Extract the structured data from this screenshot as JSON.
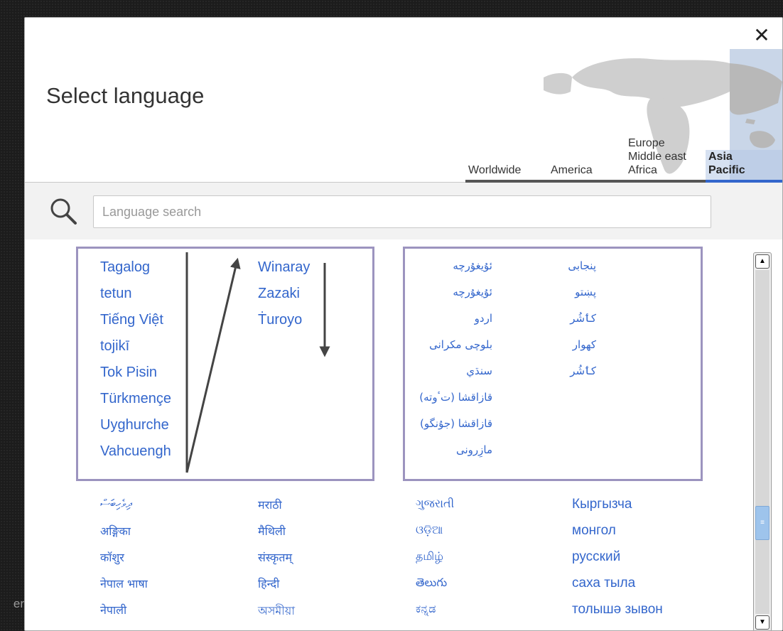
{
  "background_text": "er",
  "dialog": {
    "title": "Select language",
    "close_label": "✕",
    "regions": [
      {
        "label": "Worldwide"
      },
      {
        "label": "America"
      },
      {
        "label": "Europe\nMiddle east\nAfrica"
      },
      {
        "label": "Asia\nPacific",
        "active": true
      }
    ],
    "search": {
      "placeholder": "Language search",
      "value": ""
    }
  },
  "languages": {
    "box1_col1": [
      "Tagalog",
      "tetun",
      "Tiếng Việt",
      "tojikī",
      "Tok Pisin",
      "Türkmençe",
      "Uyghurche",
      "Vahcuengh"
    ],
    "box1_col2": [
      "Winaray",
      "Zazaki",
      "Ṫuroyo"
    ],
    "box2_col1": [
      "ئۇيغۇرچە",
      "ئۇيغۇرچە",
      "اردو",
      "بلوچی مکرانی",
      "سنڌي",
      "قازاقشا (تٴوتە)",
      "قازاقشا (جۇنگو)",
      "مازِرونی"
    ],
    "box2_col2": [
      "پنجابی",
      "پښتو",
      "کٲشُر",
      "کھوار",
      "کٲشُر"
    ],
    "lower_col1": [
      "ދިވެހިބަސް",
      "अङ्गिका",
      "कॉशुर",
      "नेपाल भाषा",
      "नेपाली"
    ],
    "lower_col2": [
      "मराठी",
      "मैथिली",
      "संस्कृतम्",
      "हिन्दी",
      "অসমীয়া"
    ],
    "lower_col3": [
      "ગુજરાતી",
      "ଓଡ଼ିଆ",
      "தமிழ்",
      "తెలుగు",
      "ಕನ್ನಡ"
    ],
    "lower_col4": [
      "Кыргызча",
      "монгол",
      "русский",
      "саха тыла",
      "толышә зывон"
    ]
  },
  "colors": {
    "link": "#3366cc",
    "annotation": "#9c94bf",
    "active_region": "#3366cc"
  },
  "icons": {
    "search": "search-icon",
    "close": "close-icon"
  }
}
